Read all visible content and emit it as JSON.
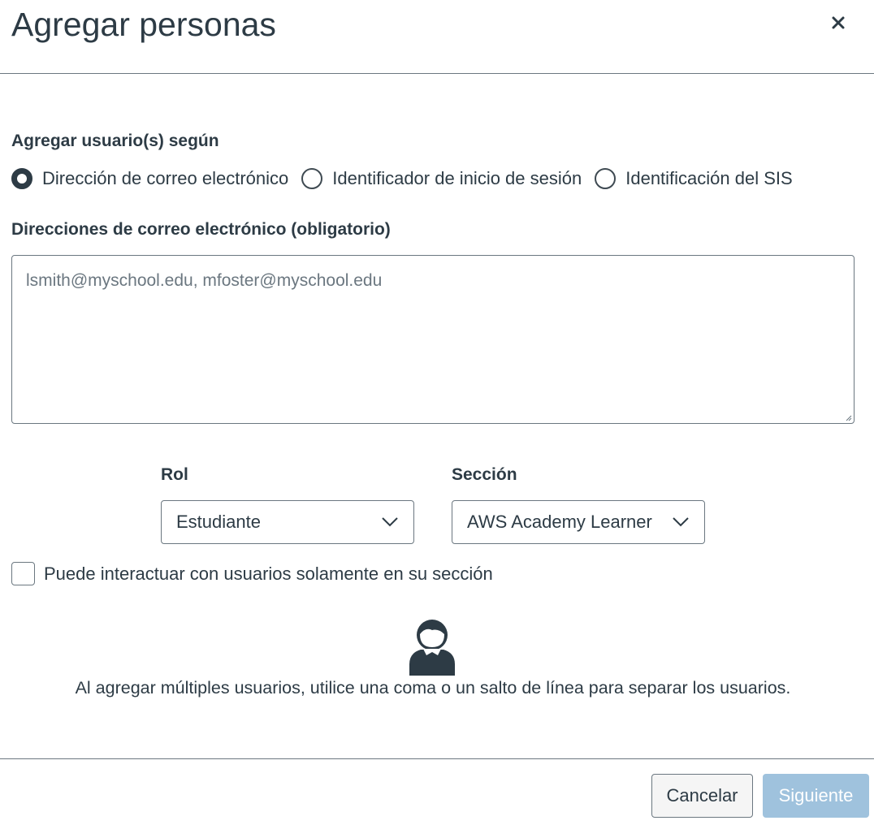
{
  "dialog": {
    "title": "Agregar personas",
    "close_icon": "close-icon"
  },
  "add_by": {
    "label": "Agregar usuario(s) según",
    "options": [
      {
        "label": "Dirección de correo electrónico",
        "checked": true
      },
      {
        "label": "Identificador de inicio de sesión",
        "checked": false
      },
      {
        "label": "Identificación del SIS",
        "checked": false
      }
    ]
  },
  "emails": {
    "label": "Direcciones de correo electrónico (obligatorio)",
    "placeholder": "lsmith@myschool.edu, mfoster@myschool.edu",
    "value": ""
  },
  "role": {
    "label": "Rol",
    "selected": "Estudiante"
  },
  "section": {
    "label": "Sección",
    "selected": "AWS Academy Learner"
  },
  "limit_checkbox": {
    "label": "Puede interactuar con usuarios solamente en su sección",
    "checked": false
  },
  "hint": {
    "icon": "person-icon",
    "text": "Al agregar múltiples usuarios, utilice una coma o un salto de línea para separar los usuarios."
  },
  "footer": {
    "cancel_label": "Cancelar",
    "next_label": "Siguiente"
  },
  "colors": {
    "text": "#2d3b45",
    "border": "#6b7780",
    "primary_disabled": "#9fc2dd"
  }
}
